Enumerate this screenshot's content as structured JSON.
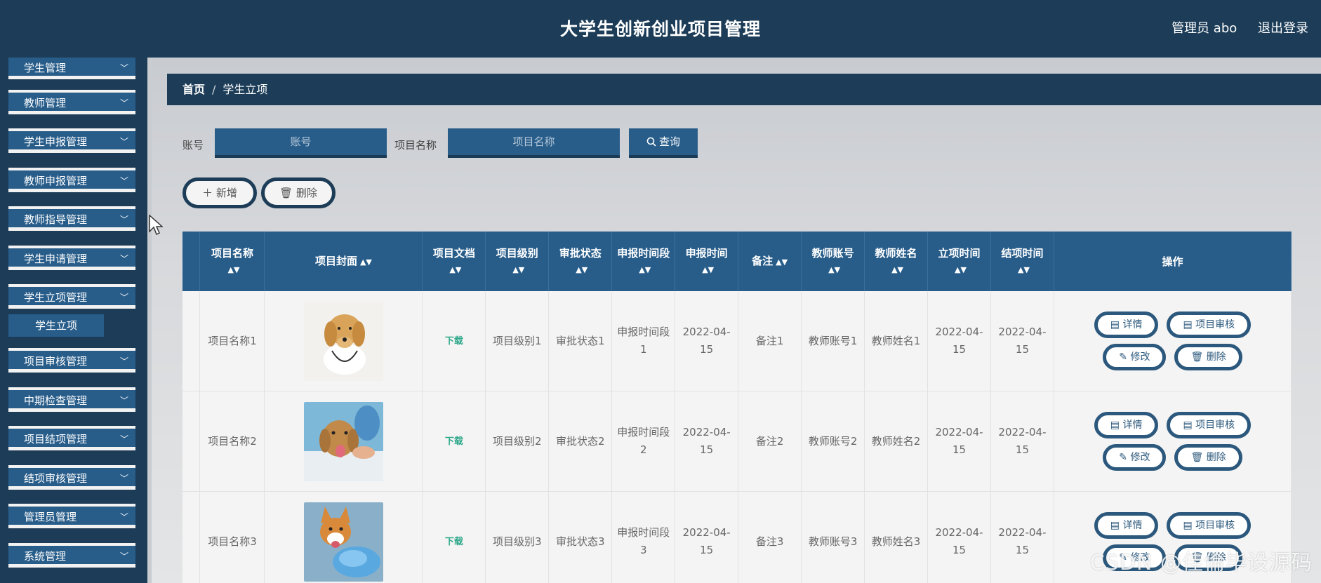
{
  "header": {
    "title": "大学生创新创业项目管理",
    "user": "管理员 abo",
    "logout": "退出登录"
  },
  "sidebar": {
    "items": [
      {
        "label": "学生管理"
      },
      {
        "label": "教师管理"
      },
      {
        "label": "学生申报管理"
      },
      {
        "label": "教师申报管理"
      },
      {
        "label": "教师指导管理"
      },
      {
        "label": "学生申请管理"
      },
      {
        "label": "学生立项管理"
      },
      {
        "label": "项目审核管理"
      },
      {
        "label": "中期检查管理"
      },
      {
        "label": "项目结项管理"
      },
      {
        "label": "结项审核管理"
      },
      {
        "label": "管理员管理"
      },
      {
        "label": "系统管理"
      }
    ],
    "sub_item": "学生立项"
  },
  "breadcrumb": {
    "home": "首页",
    "separator": "/",
    "current": "学生立项"
  },
  "search": {
    "account_label": "账号",
    "account_placeholder": "账号",
    "name_label": "项目名称",
    "name_placeholder": "项目名称",
    "query_label": "查询"
  },
  "toolbar": {
    "add_label": "新增",
    "delete_label": "删除"
  },
  "table": {
    "headers": [
      "项目名称",
      "项目封面",
      "项目文档",
      "项目级别",
      "审批状态",
      "申报时间段",
      "申报时间",
      "备注",
      "教师账号",
      "教师姓名",
      "立项时间",
      "结项时间",
      "操作"
    ],
    "rows": [
      {
        "name": "项目名称1",
        "doc": "下载",
        "level": "项目级别1",
        "status": "审批状态1",
        "period": "申报时间段1",
        "date": "2022-04-15",
        "note": "备注1",
        "teacher_account": "教师账号1",
        "teacher_name": "教师姓名1",
        "start": "2022-04-15",
        "end": "2022-04-15"
      },
      {
        "name": "项目名称2",
        "doc": "下载",
        "level": "项目级别2",
        "status": "审批状态2",
        "period": "申报时间段2",
        "date": "2022-04-15",
        "note": "备注2",
        "teacher_account": "教师账号2",
        "teacher_name": "教师姓名2",
        "start": "2022-04-15",
        "end": "2022-04-15"
      },
      {
        "name": "项目名称3",
        "doc": "下载",
        "level": "项目级别3",
        "status": "审批状态3",
        "period": "申报时间段3",
        "date": "2022-04-15",
        "note": "备注3",
        "teacher_account": "教师账号3",
        "teacher_name": "教师姓名3",
        "start": "2022-04-15",
        "end": "2022-04-15"
      }
    ],
    "actions": {
      "detail": "详情",
      "review": "项目审核",
      "edit": "修改",
      "delete": "删除"
    }
  },
  "watermark": "CSDN @佳倫毕设源码"
}
